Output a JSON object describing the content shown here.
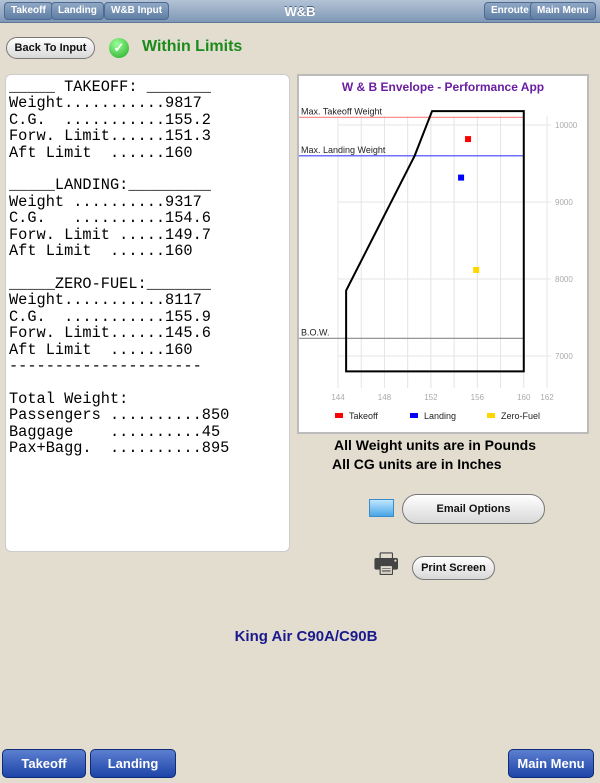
{
  "nav": {
    "title": "W&B",
    "left": [
      "Takeoff",
      "Landing",
      "W&B Input"
    ],
    "right": [
      "Enroute",
      "Main Menu"
    ]
  },
  "back_button": "Back To Input",
  "status": "Within Limits",
  "status_color": "#1a8a1a",
  "report": {
    "lines": [
      "_____ TAKEOFF: _______",
      "Weight...........9817",
      "C.G.  ...........155.2",
      "Forw. Limit......151.3",
      "Aft Limit  ......160",
      "",
      "_____LANDING:_________",
      "Weight ..........9317",
      "C.G.   ..........154.6",
      "Forw. Limit .....149.7",
      "Aft Limit  ......160",
      "",
      "_____ZERO-FUEL:_______",
      "Weight...........8117",
      "C.G.  ...........155.9",
      "Forw. Limit......145.6",
      "Aft Limit  ......160",
      "---------------------",
      "",
      "Total Weight:",
      "Passengers ..........850",
      "Baggage    ..........45",
      "Pax+Bagg.  ..........895"
    ]
  },
  "chart_data": {
    "type": "scatter",
    "title": "W & B Envelope - Performance App",
    "xlim": [
      144,
      162
    ],
    "ylim": [
      6700,
      10300
    ],
    "xticks": [
      144,
      148,
      152,
      156,
      160,
      162
    ],
    "yticks": [
      7000,
      8000,
      9000,
      10000
    ],
    "grid": true,
    "legend": "bottom",
    "envelope": [
      [
        144.7,
        6800
      ],
      [
        144.7,
        7850
      ],
      [
        150.6,
        9600
      ],
      [
        152.1,
        10180
      ],
      [
        160,
        10180
      ],
      [
        160,
        6800
      ]
    ],
    "reference_lines": [
      {
        "label": "Max. Takeoff Weight",
        "y": 10100,
        "color": "#ff8080"
      },
      {
        "label": "Max. Landing Weight",
        "y": 9600,
        "color": "#4040ff"
      },
      {
        "label": "B.O.W.",
        "y": 7230,
        "color": "#888888"
      }
    ],
    "series": [
      {
        "name": "Takeoff",
        "x": 155.2,
        "y": 9817,
        "color": "#ff0000"
      },
      {
        "name": "Landing",
        "x": 154.6,
        "y": 9317,
        "color": "#0000ff"
      },
      {
        "name": "Zero-Fuel",
        "x": 155.9,
        "y": 8117,
        "color": "#ffd700"
      }
    ]
  },
  "notes": [
    "All Weight units are in Pounds",
    "All CG units are in Inches"
  ],
  "email_button": "Email Options",
  "print_button": "Print Screen",
  "aircraft": "King Air C90A/C90B",
  "bottom": {
    "takeoff": "Takeoff",
    "landing": "Landing",
    "main_menu": "Main Menu"
  }
}
